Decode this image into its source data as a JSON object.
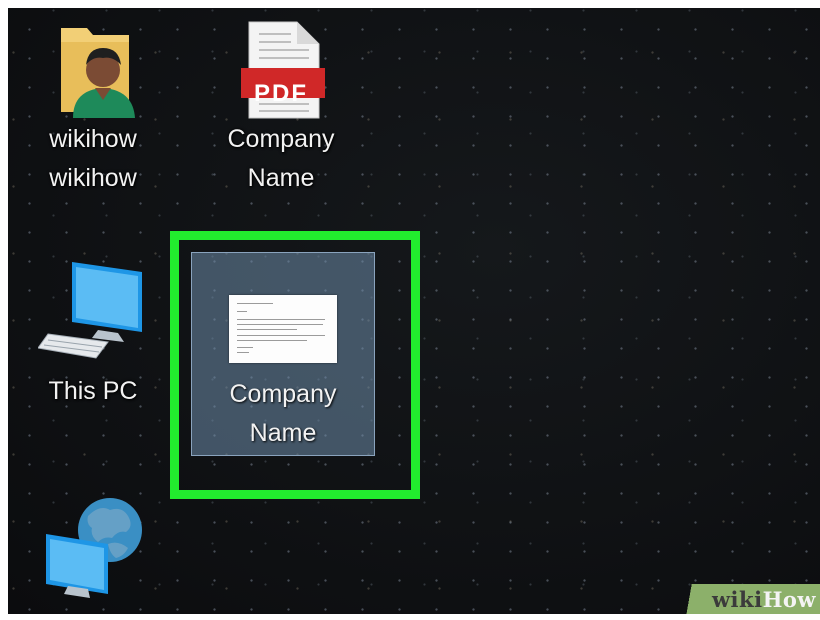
{
  "desktop": {
    "icons": [
      {
        "id": "user-folder",
        "label_line1": "wikihow",
        "label_line2": "wikihow",
        "icon": "user-folder-icon"
      },
      {
        "id": "pdf-file",
        "label_line1": "Company",
        "label_line2": "Name",
        "badge": "PDF",
        "icon": "pdf-file-icon"
      },
      {
        "id": "this-pc",
        "label_line1": "This PC",
        "icon": "computer-icon"
      },
      {
        "id": "network",
        "label_line1": "",
        "icon": "network-globe-icon"
      }
    ],
    "selected_icon": {
      "label_line1": "Company",
      "label_line2": "Name",
      "icon": "word-document-thumbnail-icon"
    }
  },
  "highlight": {
    "color": "#22ec2e"
  },
  "watermark": {
    "part1": "wiki",
    "part2": "How"
  }
}
